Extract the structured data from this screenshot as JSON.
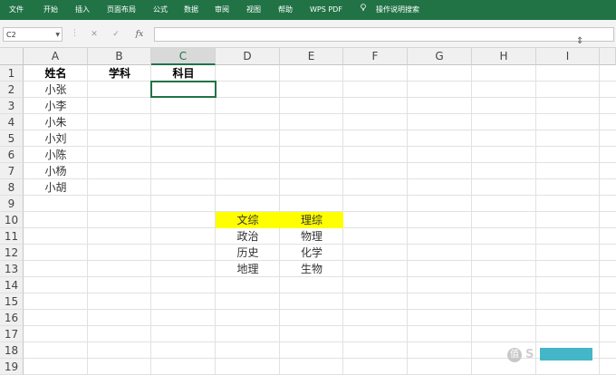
{
  "ribbon": {
    "tabs": [
      "文件",
      "开始",
      "插入",
      "页面布局",
      "公式",
      "数据",
      "审阅",
      "视图",
      "帮助",
      "WPS PDF"
    ],
    "tell_me": "操作说明搜索"
  },
  "formula_bar": {
    "name_box": "C2",
    "cancel": "✕",
    "enter": "✓",
    "fx": "fx",
    "value": ""
  },
  "columns": [
    "A",
    "B",
    "C",
    "D",
    "E",
    "F",
    "G",
    "H",
    "I"
  ],
  "rows": [
    "1",
    "2",
    "3",
    "4",
    "5",
    "6",
    "7",
    "8",
    "9",
    "10",
    "11",
    "12",
    "13",
    "14",
    "15",
    "16",
    "17",
    "18",
    "19"
  ],
  "cells": {
    "A1": "姓名",
    "B1": "学科",
    "C1": "科目",
    "A2": "小张",
    "A3": "小李",
    "A4": "小朱",
    "A5": "小刘",
    "A6": "小陈",
    "A7": "小杨",
    "A8": "小胡",
    "D10": "文综",
    "E10": "理综",
    "D11": "政治",
    "E11": "物理",
    "D12": "历史",
    "E12": "化学",
    "D13": "地理",
    "E13": "生物"
  },
  "colors": {
    "ribbon": "#217346",
    "highlight": "#ffff00",
    "selection": "#217346"
  },
  "watermark": {
    "icon": "值",
    "text": "S"
  }
}
